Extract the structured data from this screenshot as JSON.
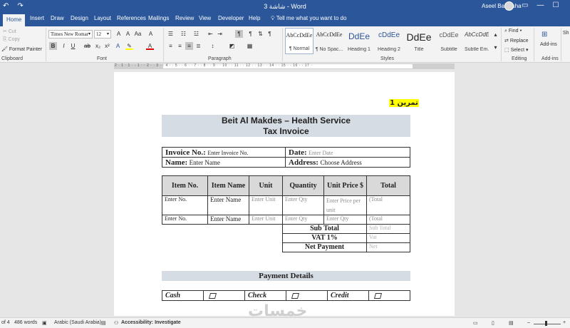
{
  "titlebar": {
    "title": "شاشة 3 - Word",
    "user": "Aseel Balousha",
    "qat": [
      "↶",
      "↷"
    ],
    "window_controls": [
      "▭",
      "—",
      "☐"
    ]
  },
  "tabs": [
    "Home",
    "Insert",
    "Draw",
    "Design",
    "Layout",
    "References",
    "Mailings",
    "Review",
    "View",
    "Developer",
    "Help"
  ],
  "tell_me": "Tell me what you want to do",
  "ribbon": {
    "clipboard": {
      "cut": "Cut",
      "copy": "Copy",
      "format_painter": "Format Painter",
      "label": "Clipboard"
    },
    "font": {
      "name": "Times New Romar",
      "size": "12",
      "label": "Font"
    },
    "paragraph": {
      "label": "Paragraph"
    },
    "styles": {
      "label": "Styles",
      "items": [
        {
          "preview": "AbCcDdEe",
          "name": "¶ Normal"
        },
        {
          "preview": "AbCcDdEe",
          "name": "¶ No Spac..."
        },
        {
          "preview": "DdEe",
          "name": "Heading 1"
        },
        {
          "preview": "cDdEe",
          "name": "Heading 2"
        },
        {
          "preview": "DdEe",
          "name": "Title"
        },
        {
          "preview": "cDdEe",
          "name": "Subtitle"
        },
        {
          "preview": "AbCcDdEe",
          "name": "Subtle Em..."
        }
      ]
    },
    "editing": {
      "find": "Find",
      "replace": "Replace",
      "select": "Select",
      "label": "Editing"
    },
    "addins": {
      "button": "Add-ins",
      "label": "Add-ins"
    },
    "extra": "Sh"
  },
  "ruler_numbers": "2 · 1 · 1 · · 1 · · 2 · · 3 · · 4 · · 5 · · 6 · · 7 · · 8 · · 9 · · 10 · · 11 · · 12 · · 13 · · 14 · · 15 · · 16 · · 17 ·",
  "document": {
    "tag": "تمرين 1",
    "title": "Beit Al Makdes – Health Service",
    "subtitle": "Tax Invoice",
    "info": {
      "invoice_no_label": "Invoice No.:",
      "invoice_no_value": "Enter Invoice No.",
      "date_label": "Date:",
      "date_value": "Enter Date",
      "name_label": "Name:",
      "name_value": "Enter Name",
      "address_label": "Address:",
      "address_value": "Choose Address"
    },
    "items_headers": [
      "Item No.",
      "Item Name",
      "Unit",
      "Quantity",
      "Unit Price $",
      "Total"
    ],
    "items_rows": [
      [
        "Enter No.",
        "Enter Name",
        "Enter Unit",
        "Enter Qty",
        "Enter Price per unit",
        "(Total"
      ],
      [
        "Enter No.",
        "Enter Name",
        "Enter Unit",
        "Enter Qty",
        "Enter Qty",
        "(Total"
      ]
    ],
    "summary": [
      {
        "label": "Sub Total",
        "value": "Sub Total"
      },
      {
        "label": "VAT 1%",
        "value": "Vat"
      },
      {
        "label": "Net Payment",
        "value": "Net"
      }
    ],
    "payment_title": "Payment Details",
    "payment": {
      "cash": "Cash",
      "check": "Check",
      "credit": "Credit"
    }
  },
  "statusbar": {
    "page": "of 4",
    "words": "486 words",
    "language": "Arabic (Saudi Arabia)",
    "accessibility": "Accessibility: Investigate"
  },
  "watermark": "خمسات",
  "colors": {
    "ribbon_blue": "#2b579a",
    "header_band": "#d6dce4",
    "highlight": "#ffff00"
  }
}
